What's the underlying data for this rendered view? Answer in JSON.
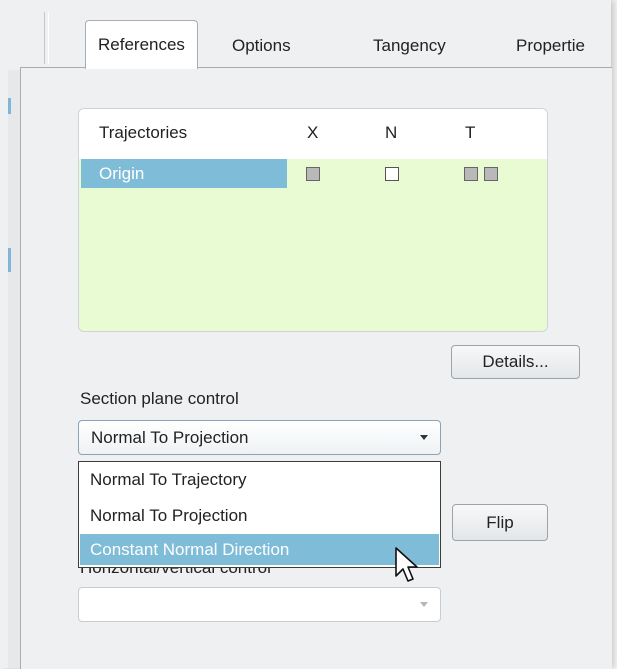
{
  "tabs": [
    {
      "label": "References",
      "active": true
    },
    {
      "label": "Options",
      "active": false
    },
    {
      "label": "Tangency",
      "active": false
    },
    {
      "label": "Propertie",
      "active": false
    }
  ],
  "trajectories_table": {
    "headers": [
      "Trajectories",
      "X",
      "N",
      "T"
    ],
    "rows": [
      {
        "name": "Origin",
        "x": "checked",
        "n": "unchecked",
        "t": [
          "checked",
          "checked"
        ]
      }
    ]
  },
  "details_button": "Details...",
  "section_plane_control": {
    "label": "Section plane control",
    "selected": "Normal To Projection",
    "options": [
      "Normal To Trajectory",
      "Normal To Projection",
      "Constant Normal Direction"
    ],
    "highlighted_option": "Constant Normal Direction"
  },
  "flip_button": "Flip",
  "horizontal_vertical_control": {
    "label": "Horizontal/vertical control",
    "selected": ""
  },
  "colors": {
    "selection": "#7fbcd7",
    "table_background": "#e9fbd3",
    "panel_background": "#eef0f2"
  }
}
